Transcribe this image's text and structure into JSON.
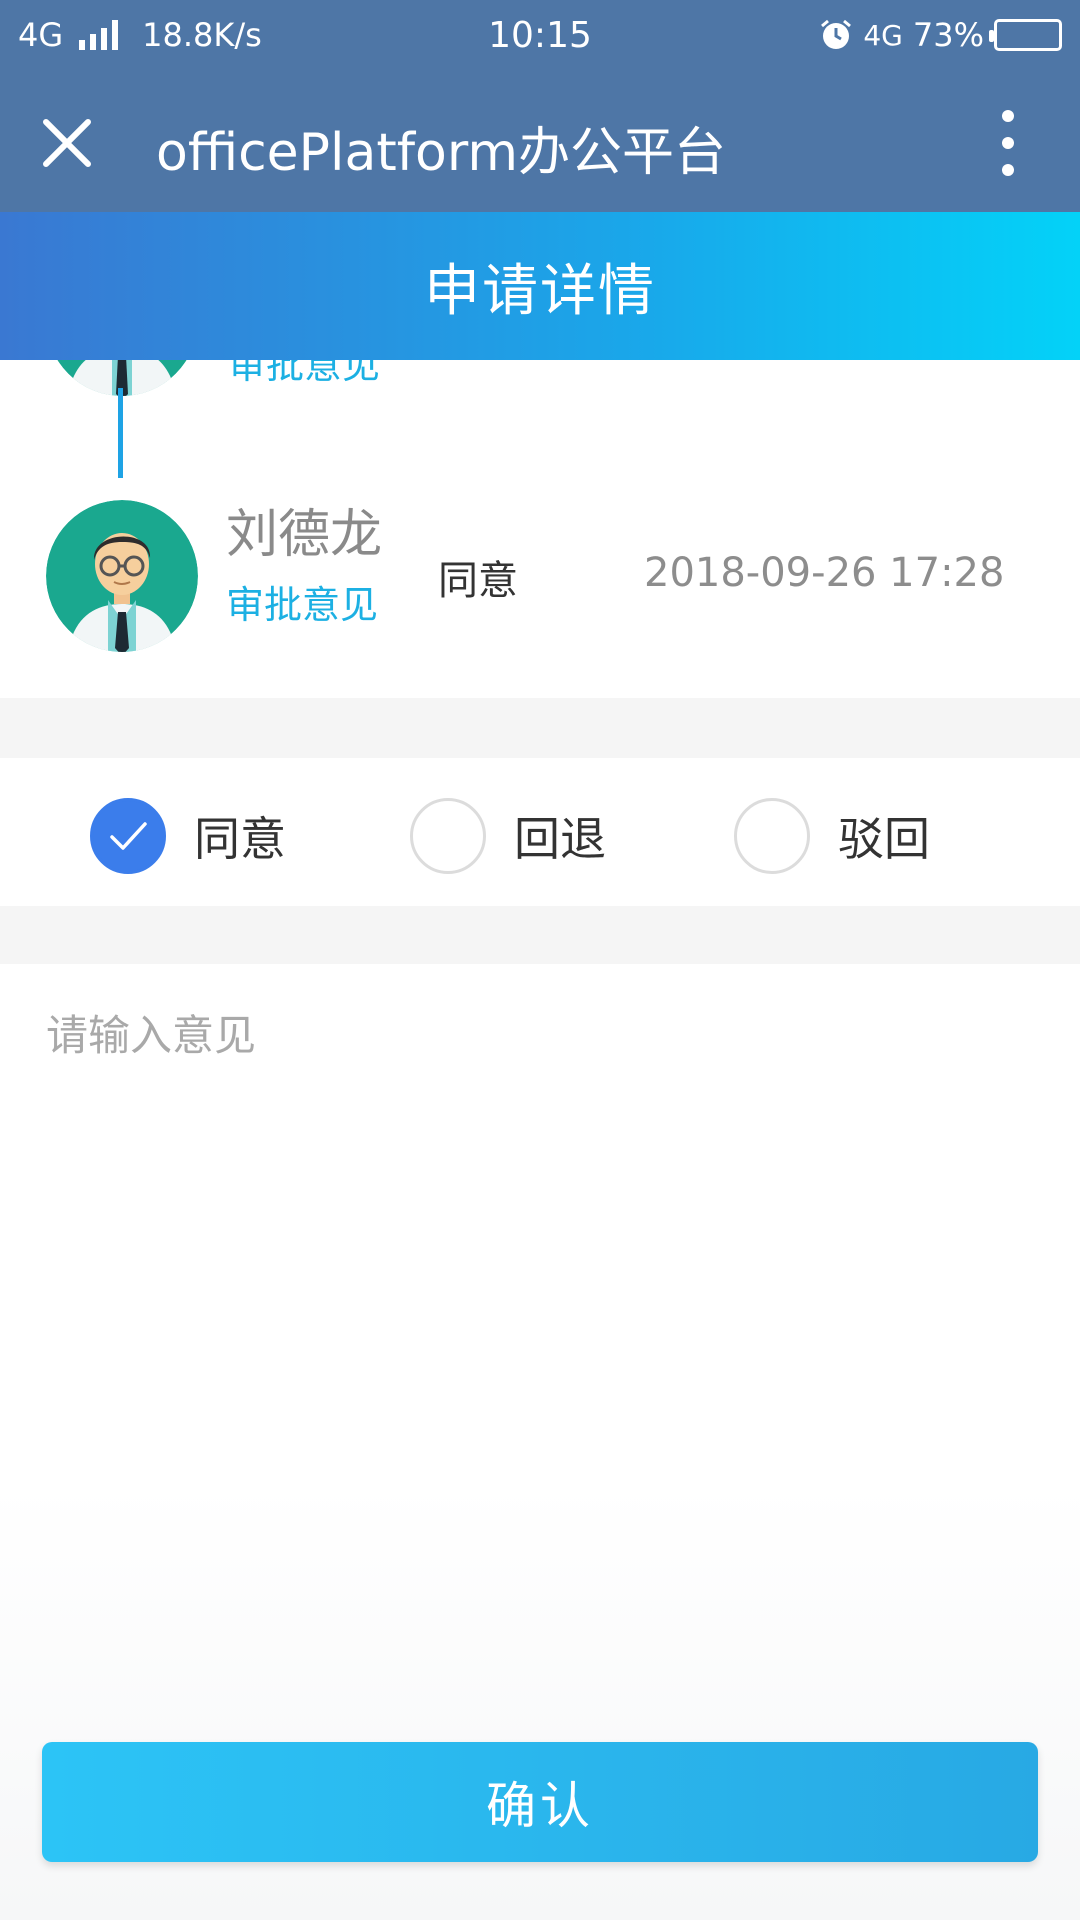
{
  "status_bar": {
    "network": "4G",
    "speed": "18.8K/s",
    "time": "10:15",
    "network2": "4G",
    "battery": "73%",
    "battery_level": 0.73
  },
  "app_bar": {
    "title": "officePlatform办公平台"
  },
  "header": {
    "title": "申请详情"
  },
  "timeline": {
    "previous_label": "审批意见",
    "entries": [
      {
        "name": "刘德龙",
        "sub_label": "审批意见",
        "opinion": "同意",
        "time": "2018-09-26 17:28"
      }
    ]
  },
  "decision": {
    "options": [
      "同意",
      "回退",
      "驳回"
    ],
    "selected": "同意"
  },
  "comment": {
    "placeholder": "请输入意见",
    "value": ""
  },
  "confirm_label": "确认",
  "colors": {
    "status_bar": "#4e76a6",
    "header_start": "#3a78d2",
    "header_end": "#03d2f8",
    "accent_link": "#1cb0e3",
    "radio_checked": "#3b7deb",
    "button": "#28a9e4"
  }
}
